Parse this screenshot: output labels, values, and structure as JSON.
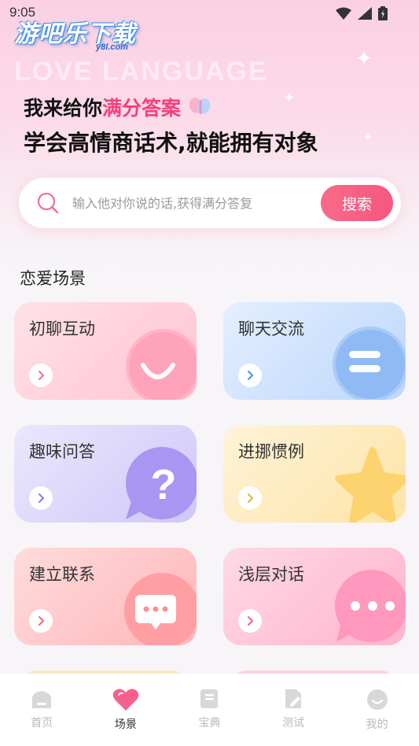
{
  "status_bar": {
    "time": "9:05"
  },
  "watermark": {
    "text": "游吧乐下载",
    "sub": "y8l.com"
  },
  "hero": {
    "bg_text": "LOVE LANGUAGE",
    "line1_prefix": "我来给你",
    "line1_accent": "满分答案",
    "line2": "学会高情商话术,就能拥有对象"
  },
  "search": {
    "placeholder": "输入他对你说的话,获得满分答复",
    "button_label": "搜索"
  },
  "section_title": "恋爱场景",
  "cards": [
    {
      "label": "初聊互动",
      "icon": "smile-icon",
      "arrow_color": "#f2708f"
    },
    {
      "label": "聊天交流",
      "icon": "chat-lines-icon",
      "arrow_color": "#4f8ce6"
    },
    {
      "label": "趣味问答",
      "icon": "question-bubble-icon",
      "arrow_color": "#8a7ae6"
    },
    {
      "label": "进挪惯例",
      "icon": "star-icon",
      "arrow_color": "#e5b340"
    },
    {
      "label": "建立联系",
      "icon": "message-dots-icon",
      "arrow_color": "#f06a6a"
    },
    {
      "label": "浅层对话",
      "icon": "ellipsis-bubble-icon",
      "arrow_color": "#f0648f"
    }
  ],
  "tabs": [
    {
      "label": "首页",
      "icon": "home-icon",
      "active": false
    },
    {
      "label": "场景",
      "icon": "heart-icon",
      "active": true
    },
    {
      "label": "宝典",
      "icon": "book-icon",
      "active": false
    },
    {
      "label": "测试",
      "icon": "test-edit-icon",
      "active": false
    },
    {
      "label": "我的",
      "icon": "profile-icon",
      "active": false
    }
  ],
  "colors": {
    "accent": "#f5407a",
    "search_button": "#f6607f"
  }
}
